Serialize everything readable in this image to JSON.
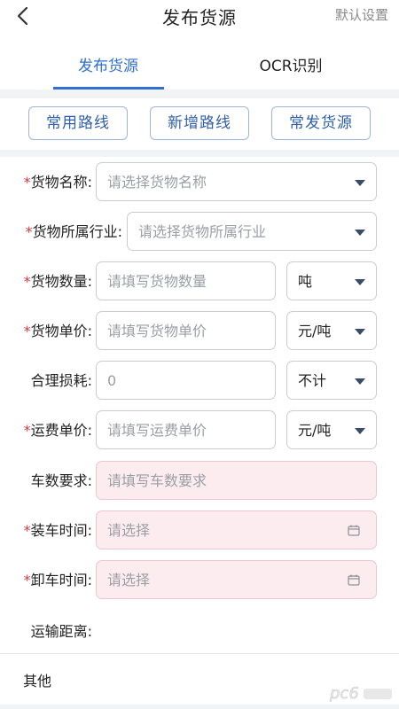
{
  "header": {
    "title": "发布货源",
    "right_label": "默认设置"
  },
  "tabs": [
    {
      "label": "发布货源",
      "active": true
    },
    {
      "label": "OCR识别",
      "active": false
    }
  ],
  "quick_buttons": [
    "常用路线",
    "新增路线",
    "常发货源"
  ],
  "form": {
    "cargo_name": {
      "label": "货物名称:",
      "required": true,
      "placeholder": "请选择货物名称"
    },
    "industry": {
      "label": "货物所属行业:",
      "required": true,
      "placeholder": "请选择货物所属行业"
    },
    "quantity": {
      "label": "货物数量:",
      "required": true,
      "placeholder": "请填写货物数量",
      "unit": "吨"
    },
    "unit_price": {
      "label": "货物单价:",
      "required": true,
      "placeholder": "请填写货物单价",
      "unit": "元/吨"
    },
    "loss": {
      "label": "合理损耗:",
      "required": false,
      "value": "0",
      "unit": "不计"
    },
    "freight_price": {
      "label": "运费单价:",
      "required": true,
      "placeholder": "请填写运费单价",
      "unit": "元/吨"
    },
    "trucks": {
      "label": "车数要求:",
      "required": false,
      "placeholder": "请填写车数要求"
    },
    "load_time": {
      "label": "装车时间:",
      "required": true,
      "placeholder": "请选择"
    },
    "unload_time": {
      "label": "卸车时间:",
      "required": true,
      "placeholder": "请选择"
    },
    "distance": {
      "label": "运输距离:"
    }
  },
  "other_label": "其他",
  "required_mark": "*",
  "colors": {
    "accent": "#2f6fd0",
    "required": "#e0353b",
    "pink_field": "#fdecef"
  },
  "watermark_text": "pc6"
}
